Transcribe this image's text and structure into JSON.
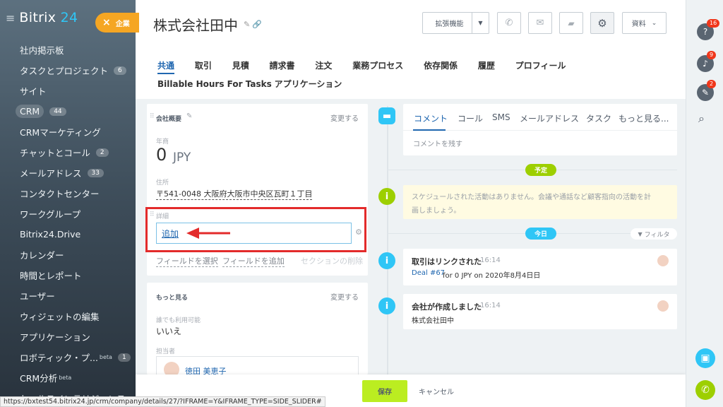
{
  "sidebar": {
    "logo_main": "Bitrix",
    "logo_accent": "24",
    "items": [
      {
        "label": "社内掲示板",
        "badge": ""
      },
      {
        "label": "タスクとプロジェクト",
        "badge": "6"
      },
      {
        "label": "サイト",
        "badge": ""
      },
      {
        "label": "CRM",
        "badge": "44"
      },
      {
        "label": "CRMマーケティング",
        "badge": ""
      },
      {
        "label": "チャットとコール",
        "badge": "2"
      },
      {
        "label": "メールアドレス",
        "badge": "33"
      },
      {
        "label": "コンタクトセンター",
        "badge": ""
      },
      {
        "label": "ワークグループ",
        "badge": ""
      },
      {
        "label": "Bitrix24.Drive",
        "badge": ""
      },
      {
        "label": "カレンダー",
        "badge": ""
      },
      {
        "label": "時間とレポート",
        "badge": ""
      },
      {
        "label": "ユーザー",
        "badge": ""
      },
      {
        "label": "ウィジェットの編集",
        "badge": ""
      },
      {
        "label": "アプリケーション",
        "badge": ""
      },
      {
        "label": "ロボティック・プ...",
        "badge": "1",
        "beta": "beta"
      },
      {
        "label": "CRM分析",
        "badge": "",
        "beta": "beta"
      },
      {
        "label": "セールスインテリジェンス",
        "badge": ""
      }
    ]
  },
  "company_tab": {
    "close": "×",
    "label": "企業"
  },
  "header": {
    "title": "株式会社田中",
    "ext_button": "拡張機能",
    "docs_button": "資料",
    "tabs": [
      "共通",
      "取引",
      "見積",
      "請求書",
      "注文",
      "業務プロセス",
      "依存関係",
      "履歴",
      "プロフィール",
      "Billable Hours For Tasks",
      "アプリケーション"
    ]
  },
  "overview": {
    "title": "会社概要",
    "change": "変更する",
    "revenue_label": "年商",
    "revenue_value": "0",
    "revenue_currency": "JPY",
    "address_label": "住所",
    "address_value": "〒541-0048 大阪府大阪市中央区瓦町１丁目",
    "details_label": "詳細",
    "add_label": "追加",
    "select_field": "フィールドを選択",
    "add_field": "フィールドを追加",
    "delete_section": "セクションの削除"
  },
  "more": {
    "title": "もっと見る",
    "change": "変更する",
    "available_label": "誰でも利用可能",
    "available_value": "いいえ",
    "assignee_label": "担当者",
    "assignee_name": "徳田 美恵子"
  },
  "timeline": {
    "tabs": [
      "コメント",
      "コール",
      "SMS",
      "メールアドレス",
      "タスク",
      "もっと見る..."
    ],
    "comment_placeholder": "コメントを残す",
    "planned_pill": "予定",
    "planned_text": "スケジュールされた活動はありません。会議や通話など顧客指向の活動を計画しましょう。",
    "today_pill": "今日",
    "filter": "フィルタ",
    "events": [
      {
        "title": "取引はリンクされた",
        "time": "16:14",
        "link": "Deal #67",
        "detail": " for 0 JPY on 2020年8月4日日"
      },
      {
        "title": "会社が作成しました",
        "time": "16:14",
        "link": "",
        "detail": "株式会社田中"
      }
    ]
  },
  "bottom": {
    "save": "保存",
    "cancel": "キャンセル"
  },
  "right_panel": {
    "help_count": "16",
    "bell_count": "9",
    "chat_count": "2"
  },
  "status_url": "https://bxtest54.bitrix24.jp/crm/company/details/27/?IFRAME=Y&IFRAME_TYPE=SIDE_SLIDER#",
  "colors": {
    "accent": "#2067b0",
    "green": "#9dcf00",
    "info": "#2fc6f6",
    "orange": "#f5a623",
    "red_box": "#e32b2b"
  }
}
